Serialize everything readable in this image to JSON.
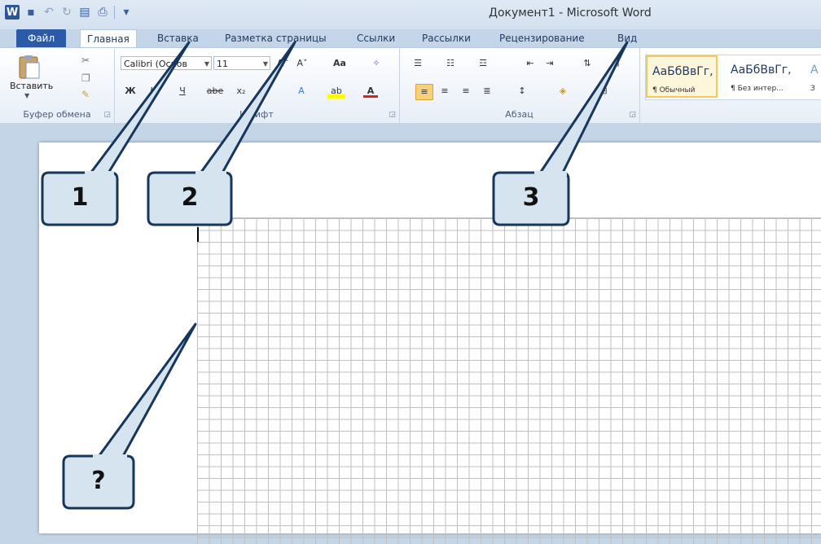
{
  "window": {
    "title": "Документ1  -  Microsoft Word"
  },
  "quick_access": {
    "icons": [
      "word-logo",
      "save-icon",
      "undo-icon",
      "redo-icon",
      "print-preview-icon",
      "print-icon",
      "customize-qat-icon"
    ]
  },
  "tabs": {
    "file": "Файл",
    "home": "Главная",
    "insert": "Вставка",
    "page_layout": "Разметка страницы",
    "references": "Ссылки",
    "mailings": "Рассылки",
    "review": "Рецензирование",
    "view": "Вид"
  },
  "ribbon": {
    "clipboard": {
      "label": "Буфер обмена",
      "paste": "Вставить"
    },
    "font": {
      "label": "Шрифт",
      "font_name": "Calibri (Основ",
      "font_size": "11",
      "case_btn": "Aa",
      "bold": "Ж",
      "italic": "К",
      "underline": "Ч",
      "strike": "abe",
      "subscript": "x₂",
      "font_color": "A"
    },
    "paragraph": {
      "label": "Абзац"
    },
    "styles": [
      {
        "preview": "АаБбВвГг,",
        "name": "¶ Обычный"
      },
      {
        "preview": "АаБбВвГг,",
        "name": "¶ Без интер..."
      },
      {
        "preview": "А",
        "name": "З"
      }
    ]
  },
  "callouts": {
    "c1": "1",
    "c2": "2",
    "c3": "3",
    "q": "?"
  },
  "colors": {
    "file_tab": "#2a5aa8",
    "callout_fill": "#d6e4f0",
    "callout_stroke": "#16365c",
    "grid": "#bfbfbf"
  }
}
